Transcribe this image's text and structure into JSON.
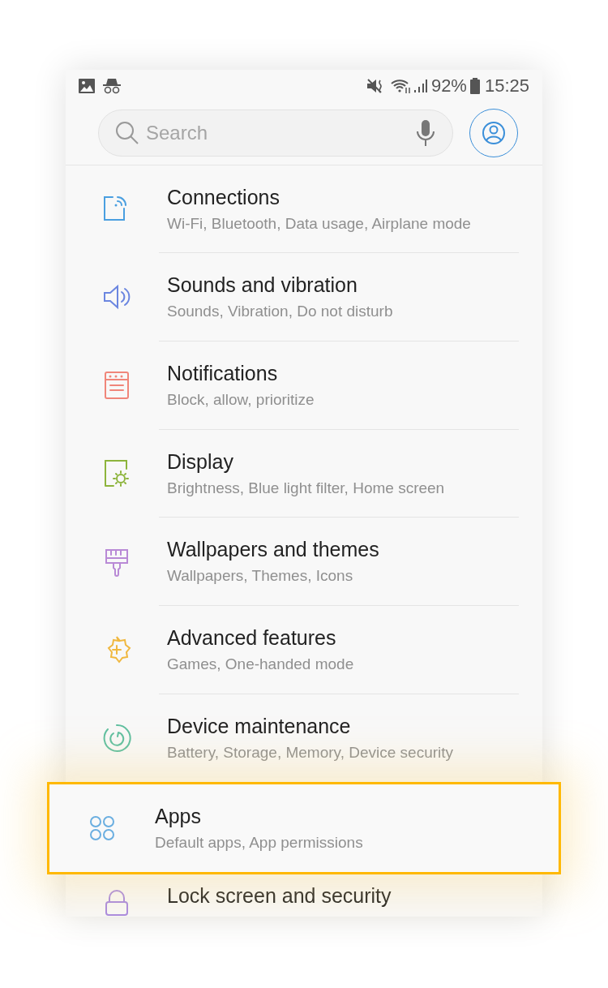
{
  "status_bar": {
    "battery": "92%",
    "time": "15:25"
  },
  "search": {
    "placeholder": "Search"
  },
  "items": [
    {
      "title": "Connections",
      "subtitle": "Wi-Fi, Bluetooth, Data usage, Airplane mode",
      "color": "#4a9fe0",
      "selected": false
    },
    {
      "title": "Sounds and vibration",
      "subtitle": "Sounds, Vibration, Do not disturb",
      "color": "#6b86e0",
      "selected": false
    },
    {
      "title": "Notifications",
      "subtitle": "Block, allow, prioritize",
      "color": "#f0867a",
      "selected": false
    },
    {
      "title": "Display",
      "subtitle": "Brightness, Blue light filter, Home screen",
      "color": "#8db43c",
      "selected": false
    },
    {
      "title": "Wallpapers and themes",
      "subtitle": "Wallpapers, Themes, Icons",
      "color": "#b98ad6",
      "selected": false
    },
    {
      "title": "Advanced features",
      "subtitle": "Games, One-handed mode",
      "color": "#f0b840",
      "selected": false
    },
    {
      "title": "Device maintenance",
      "subtitle": "Battery, Storage, Memory, Device security",
      "color": "#5fbfa0",
      "selected": false
    },
    {
      "title": "Apps",
      "subtitle": "Default apps, App permissions",
      "color": "#6aaee0",
      "selected": true
    },
    {
      "title": "Lock screen and security",
      "color": "#a98ae0",
      "selected": false
    }
  ]
}
